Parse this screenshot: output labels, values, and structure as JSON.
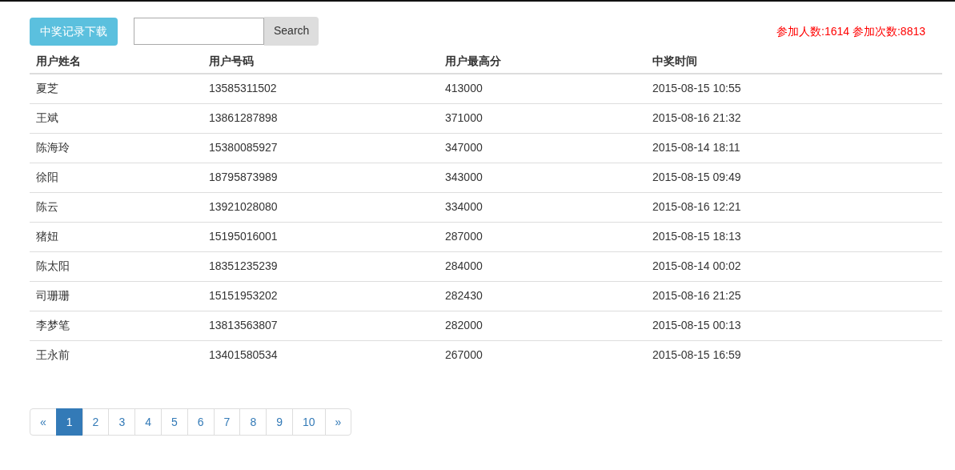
{
  "download_button": "中奖记录下载",
  "search": {
    "button": "Search"
  },
  "stats": "参加人数:1614 参加次数:8813",
  "table": {
    "columns": [
      "用户姓名",
      "用户号码",
      "用户最高分",
      "中奖时间"
    ],
    "rows": [
      [
        "夏芝",
        "13585311502",
        "413000",
        "2015-08-15 10:55"
      ],
      [
        "王斌",
        "13861287898",
        "371000",
        "2015-08-16 21:32"
      ],
      [
        "陈海玲",
        "15380085927",
        "347000",
        "2015-08-14 18:11"
      ],
      [
        "徐阳",
        "18795873989",
        "343000",
        "2015-08-15 09:49"
      ],
      [
        "陈云",
        "13921028080",
        "334000",
        "2015-08-16 12:21"
      ],
      [
        "猪妞",
        "15195016001",
        "287000",
        "2015-08-15 18:13"
      ],
      [
        "陈太阳",
        "18351235239",
        "284000",
        "2015-08-14 00:02"
      ],
      [
        "司珊珊",
        "15151953202",
        "282430",
        "2015-08-16 21:25"
      ],
      [
        "李梦笔",
        "13813563807",
        "282000",
        "2015-08-15 00:13"
      ],
      [
        "王永前",
        "13401580534",
        "267000",
        "2015-08-15 16:59"
      ]
    ]
  },
  "pagination": [
    {
      "label": "«",
      "selected": false
    },
    {
      "label": "1",
      "selected": true
    },
    {
      "label": "2",
      "selected": false
    },
    {
      "label": "3",
      "selected": false
    },
    {
      "label": "4",
      "selected": false
    },
    {
      "label": "5",
      "selected": false
    },
    {
      "label": "6",
      "selected": false
    },
    {
      "label": "7",
      "selected": false
    },
    {
      "label": "8",
      "selected": false
    },
    {
      "label": "9",
      "selected": false
    },
    {
      "label": "10",
      "selected": false
    },
    {
      "label": "»",
      "selected": false
    }
  ]
}
